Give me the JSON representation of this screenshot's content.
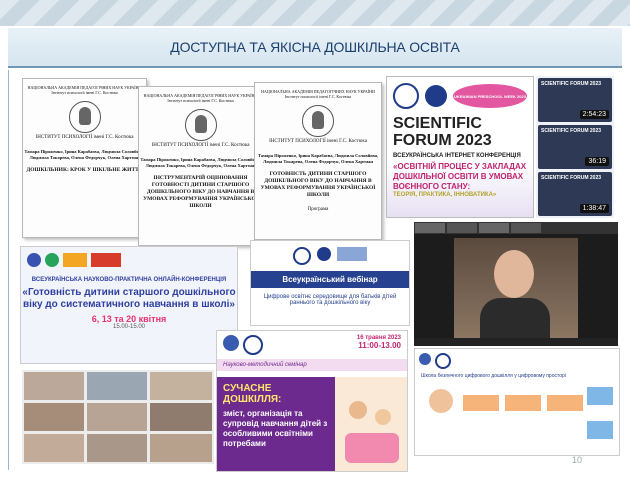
{
  "slide": {
    "title": "ДОСТУПНА ТА ЯКІСНА ДОШКІЛЬНА ОСВІТА",
    "page_number": "10"
  },
  "documents": [
    {
      "header": "НАЦІОНАЛЬНА АКАДЕМІЯ ПЕДАГОГІЧНИХ НАУК УКРАЇНИ Інститут психології імені Г.С. Костюка",
      "institute": "ІНСТИТУТ ПСИХОЛОГІЇ імені Г.С. Костюка",
      "authors": "Тамара Піроженко, Ірина Карабаєва, Людмила Соловйова, Людмила Токарева, Олена Федорчук, Олена Хартман",
      "title": "ДОШКІЛЬНИК: КРОК У ШКІЛЬНЕ ЖИТТЯ"
    },
    {
      "header": "НАЦІОНАЛЬНА АКАДЕМІЯ ПЕДАГОГІЧНИХ НАУК УКРАЇНИ Інститут психології імені Г.С. Костюка",
      "institute": "ІНСТИТУТ ПСИХОЛОГІЇ імені Г.С. Костюка",
      "authors": "Тамара Піроженко, Ірина Карабаєва, Людмила Соловйова, Людмила Токарева, Олена Федорчук, Олена Хартман",
      "title": "ІНСТРУМЕНТАРІЙ ОЦІНЮВАННЯ ГОТОВНОСТІ ДИТИНИ СТАРШОГО ДОШКІЛЬНОГО ВІКУ ДО НАВЧАННЯ В УМОВАХ РЕФОРМУВАННЯ УКРАЇНСЬКОЇ ШКОЛИ"
    },
    {
      "header": "НАЦІОНАЛЬНА АКАДЕМІЯ ПЕДАГОГІЧНИХ НАУК УКРАЇНИ Інститут психології імені Г.С. Костюка",
      "institute": "ІНСТИТУТ ПСИХОЛОГІЇ імені Г.С. Костюка",
      "authors": "Тамара Піроженко, Ірина Карабаєва, Людмила Соловйова, Людмила Токарева, Олена Федорчук, Олена Хартман",
      "title": "ГОТОВНІСТЬ ДИТИНИ СТАРШОГО ДОШКІЛЬНОГО ВІКУ ДО НАВЧАННЯ В УМОВАХ РЕФОРМУВАННЯ УКРАЇНСЬКОЇ ШКОЛИ",
      "subtitle": "Програма"
    }
  ],
  "forum": {
    "title_line1": "SCIENTIFIC",
    "title_line2": "FORUM 2023",
    "subtitle": "ВСЕУКРАЇНСЬКА ІНТЕРНЕТ КОНФЕРЕНЦІЯ",
    "red_text": "«ОСВІТНІЙ ПРОЦЕС У ЗАКЛАДАХ ДОШКІЛЬНОЇ ОСВІТИ В УМОВАХ ВОЄННОГО СТАНУ:",
    "green_text": "ТЕОРІЯ, ПРАКТИКА, ІННОВАТИКА»",
    "badge": "UKRAINIAN PRESCHOOL WEEK 2023"
  },
  "videos": [
    {
      "title": "SCIENTIFIC FORUM 2023",
      "duration": "2:54:23"
    },
    {
      "title": "SCIENTIFIC FORUM 2023",
      "duration": "36:19"
    },
    {
      "title": "SCIENTIFIC FORUM 2023",
      "duration": "1:38:47"
    }
  ],
  "conference": {
    "header": "ВСЕУКРАЇНСЬКА НАУКОВО-ПРАКТИЧНА ОНЛАЙН-КОНФЕРЕНЦІЯ",
    "title": "«Готовність дитини старшого дошкільного віку до систематичного навчання в школі»",
    "dates": "6, 13 та 20 квітня",
    "time": "15.00-15.00"
  },
  "webinar": {
    "title": "Всеукраїнський вебінар",
    "text": "Цифрове освітнє середовище для батьків дітей раннього та дошкільного віку"
  },
  "seminar": {
    "date": "16 травня 2023",
    "time": "11:00-13.00",
    "label": "Науково-методичний семінар",
    "heading": "СУЧАСНЕ ДОШКІЛЛЯ:",
    "text": "зміст, організація та супровід навчання дітей з особливими освітніми потребами"
  },
  "diagram": {
    "caption": "Школа безпечного цифрового дошкілля у цифровому просторі"
  },
  "colors": {
    "title_text": "#1d3f6e",
    "accent_pink": "#c0246e",
    "seminar_purple": "#6c2a8e"
  }
}
